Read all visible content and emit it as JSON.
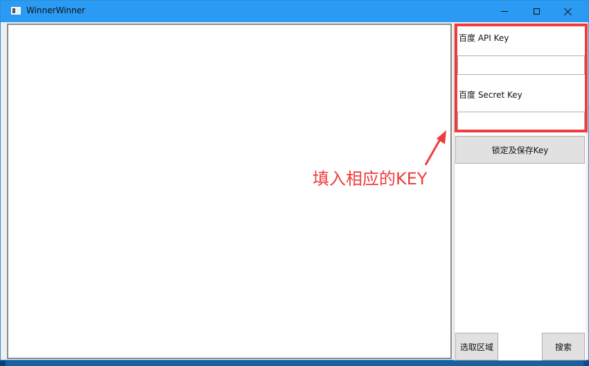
{
  "window": {
    "title": "WinnerWinner"
  },
  "panel": {
    "api_key_label": "百度 API Key",
    "api_key_value": "",
    "secret_key_label": "百度 Secret Key",
    "secret_key_value": "",
    "lock_save_button": "锁定及保存Key",
    "select_region_button": "选取区域",
    "search_button": "搜索"
  },
  "annotation": {
    "text": "填入相应的KEY",
    "color": "#ef3b3b"
  },
  "colors": {
    "titlebar": "#2b9af3",
    "highlight": "#ef3b3b"
  }
}
